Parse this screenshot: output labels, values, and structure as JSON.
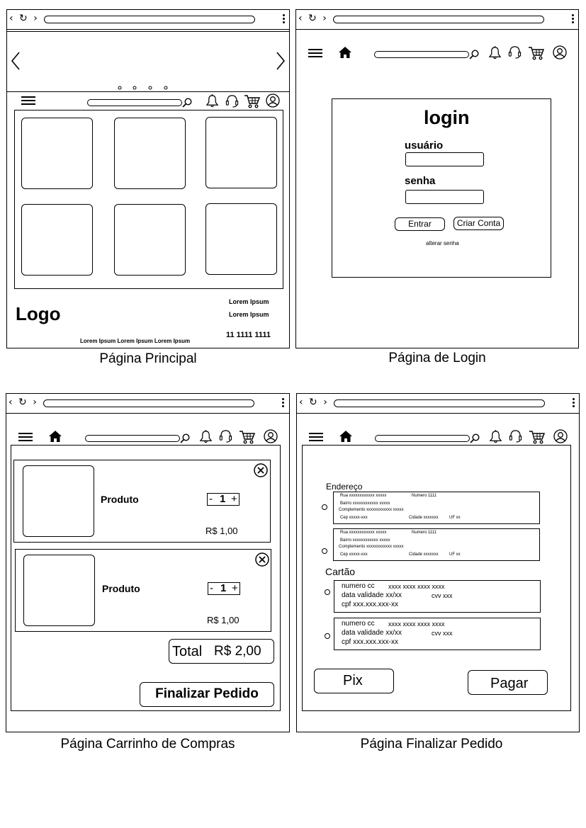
{
  "browser": {
    "nav_glyphs": "‹ ↻ ›"
  },
  "icons": [
    "back-icon",
    "reload-icon",
    "forward-icon",
    "menu-icon",
    "home-icon",
    "search-icon",
    "bell-icon",
    "support-headset-icon",
    "cart-icon",
    "user-icon",
    "close-icon",
    "chevron-left-icon",
    "chevron-right-icon"
  ],
  "main_page": {
    "caption": "Página Principal",
    "logo": "Logo",
    "footer_links": [
      "Lorem Ipsum",
      "Lorem Ipsum"
    ],
    "phone": "11 1111 1111",
    "footer_text": "Lorem Ipsum Lorem Ipsum Lorem Ipsum"
  },
  "login_page": {
    "caption": "Página de Login",
    "title": "login",
    "user_label": "usuário",
    "password_label": "senha",
    "enter_button": "Entrar",
    "create_account_button": "Criar Conta",
    "change_password": "alterar senha"
  },
  "cart_page": {
    "caption": "Página Carrinho de Compras",
    "items": [
      {
        "name": "Produto",
        "qty_minus": "-",
        "qty": "1",
        "qty_plus": "+",
        "price": "R$ 1,00"
      },
      {
        "name": "Produto",
        "qty_minus": "-",
        "qty": "1",
        "qty_plus": "+",
        "price": "R$ 1,00"
      }
    ],
    "total_label": "Total",
    "total_value": "R$ 2,00",
    "checkout_button": "Finalizar Pedido"
  },
  "checkout_page": {
    "caption": "Página Finalizar Pedido",
    "address_title": "Endereço",
    "addresses": [
      {
        "line1": "Rua xxxxxxxxxxxx xxxxx",
        "number": "Numero 1111",
        "line2": "Bairro xxxxxxxxxxxx xxxxx",
        "line3": "Complemento xxxxxxxxxxxx xxxxx",
        "cep": "Cep xxxxx-xxx",
        "city": "Cidade xxxxxxx",
        "uf": "UF xx"
      },
      {
        "line1": "Rua xxxxxxxxxxxx xxxxx",
        "number": "Numero 1111",
        "line2": "Bairro xxxxxxxxxxxx xxxxx",
        "line3": "Complemento xxxxxxxxxxxx xxxxx",
        "cep": "Cep xxxxx-xxx",
        "city": "Cidade xxxxxxx",
        "uf": "UF xx"
      }
    ],
    "card_title": "Cartão",
    "cards": [
      {
        "number_label": "numero cc",
        "number": "xxxx xxxx xxxx xxxx",
        "validity": "data validade xx/xx",
        "cvv": "cvv xxx",
        "cpf": "cpf xxx.xxx.xxx-xx"
      },
      {
        "number_label": "numero cc",
        "number": "xxxx xxxx xxxx xxxx",
        "validity": "data validade xx/xx",
        "cvv": "cvv xxx",
        "cpf": "cpf xxx.xxx.xxx-xx"
      }
    ],
    "pix_button": "Pix",
    "pay_button": "Pagar"
  }
}
